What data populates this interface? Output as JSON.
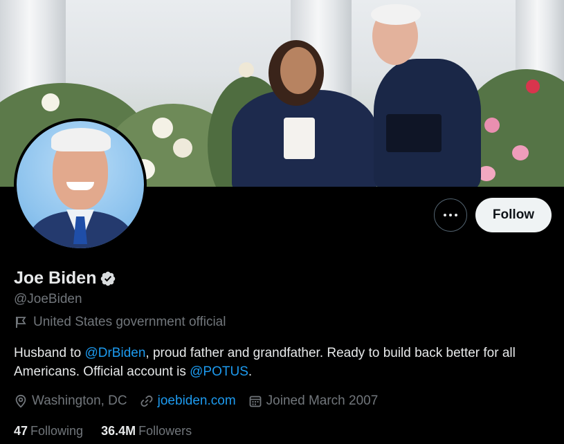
{
  "profile": {
    "name": "Joe Biden",
    "handle": "@JoeBiden",
    "label": "United States government official",
    "bio": {
      "part1": "Husband to ",
      "mention1": "@DrBiden",
      "part2": ", proud father and grandfather. Ready to build back better for all Americans. Official account is ",
      "mention2": "@POTUS",
      "part3": "."
    },
    "location": "Washington, DC",
    "website": "joebiden.com",
    "joined": "Joined March 2007",
    "following_count": "47",
    "following_label": "Following",
    "followers_count": "36.4M",
    "followers_label": "Followers"
  },
  "actions": {
    "follow_label": "Follow"
  },
  "icons": {
    "more": "more-icon",
    "verified": "verified-badge-icon",
    "label": "flag-icon",
    "location": "location-pin-icon",
    "website": "link-icon",
    "joined": "calendar-icon"
  },
  "colors": {
    "background": "#000000",
    "text_primary": "#e7e9ea",
    "text_secondary": "#71767b",
    "link": "#1d9bf0",
    "follow_button_bg": "#eff3f4"
  }
}
